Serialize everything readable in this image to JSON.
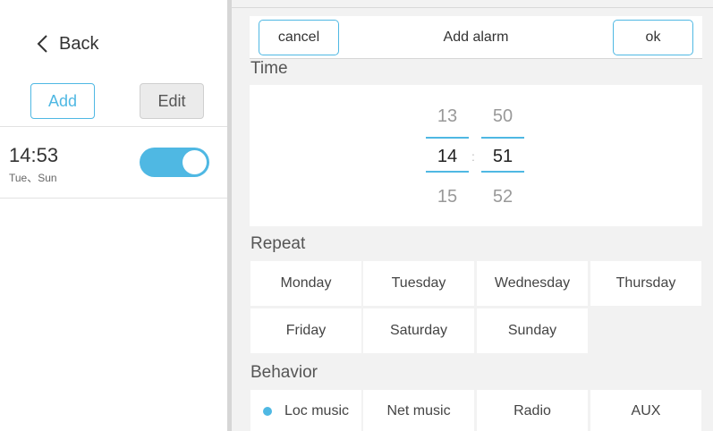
{
  "sidebar": {
    "back_label": "Back",
    "add_label": "Add",
    "edit_label": "Edit",
    "alarms": [
      {
        "time": "14:53",
        "days": "Tue、Sun",
        "enabled": true
      }
    ]
  },
  "header": {
    "cancel_label": "cancel",
    "title": "Add alarm",
    "ok_label": "ok"
  },
  "time": {
    "label": "Time",
    "hours": {
      "prev": "13",
      "selected": "14",
      "next": "15"
    },
    "minutes": {
      "prev": "50",
      "selected": "51",
      "next": "52"
    },
    "separator": ":"
  },
  "repeat": {
    "label": "Repeat",
    "days": [
      "Monday",
      "Tuesday",
      "Wednesday",
      "Thursday",
      "Friday",
      "Saturday",
      "Sunday"
    ]
  },
  "behavior": {
    "label": "Behavior",
    "options": [
      "Loc music",
      "Net music",
      "Radio",
      "AUX"
    ],
    "selected": "Loc music"
  },
  "colors": {
    "accent": "#4fb8e3",
    "background": "#f2f2f2"
  }
}
